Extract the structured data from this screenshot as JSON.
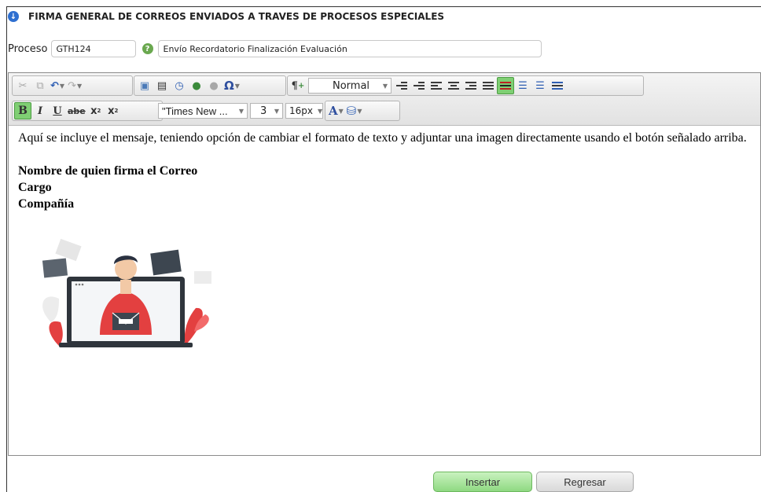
{
  "header": {
    "title": "FIRMA GENERAL DE CORREOS ENVIADOS A TRAVES DE PROCESOS ESPECIALES",
    "info_icon": "info-icon"
  },
  "process": {
    "label": "Proceso",
    "code": "GTH124",
    "help_icon": "help-icon",
    "description": "Envío Recordatorio Finalización Evaluación"
  },
  "toolbar": {
    "row1_icons": [
      "cut-icon",
      "copy-icon",
      "undo-icon",
      "redo-icon",
      "image-icon",
      "template-icon",
      "clock-icon",
      "link-icon",
      "unlink-icon",
      "special-char-icon",
      "paragraph-icon",
      "outdent-icon",
      "indent-icon",
      "align-left-icon",
      "align-center-icon",
      "align-right-icon",
      "justify-icon",
      "table-icon",
      "bullet-list-icon",
      "numbered-list-icon",
      "horizontal-rule-icon"
    ],
    "special_char": "Ω",
    "paragraph_symbol": "¶",
    "format_value": "Normal",
    "bold": "B",
    "italic": "I",
    "underline": "U",
    "strike": "abe",
    "superscript": "x",
    "subscript": "x",
    "font_value": "\"Times New ...",
    "size_value": "3",
    "px_value": "16px",
    "font_color": "A",
    "active_color": "#7fcf73"
  },
  "content": {
    "message": "Aquí se incluye el mensaje, teniendo opción de cambiar el formato de texto y adjuntar una imagen directamente usando el botón señalado arriba.",
    "signer": "Nombre de quien firma el Correo",
    "position": "Cargo",
    "company": "Compañía",
    "image_icon": "email-illustration"
  },
  "buttons": {
    "insert": "Insertar",
    "back": "Regresar"
  }
}
